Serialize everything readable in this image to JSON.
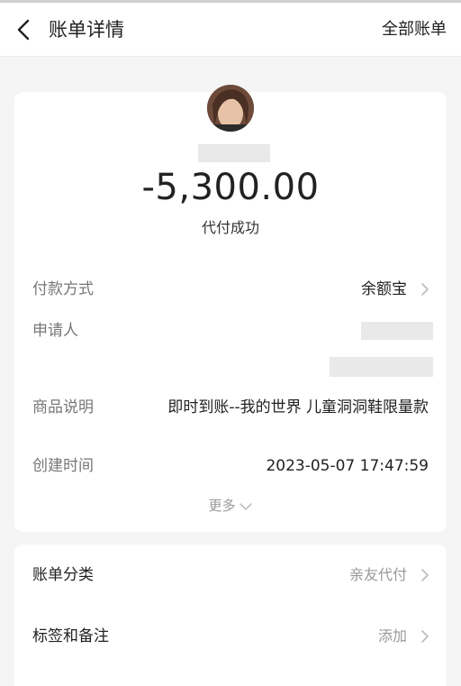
{
  "header": {
    "title": "账单详情",
    "right_link": "全部账单"
  },
  "summary": {
    "amount": "-5,300.00",
    "status": "代付成功"
  },
  "details": {
    "payment_method_label": "付款方式",
    "payment_method_value": "余额宝",
    "applicant_label": "申请人",
    "product_label": "商品说明",
    "product_value": "即时到账--我的世界 儿童洞洞鞋限量款",
    "created_label": "创建时间",
    "created_value": "2023-05-07 17:47:59",
    "more_label": "更多"
  },
  "extras": {
    "category_label": "账单分类",
    "category_value": "亲友代付",
    "tags_label": "标签和备注",
    "tags_value": "添加"
  },
  "icons": [
    "back-arrow-icon",
    "chevron-right-icon",
    "chevron-down-icon",
    "avatar"
  ],
  "colors": {
    "background": "#f5f5f5",
    "card": "#ffffff",
    "muted": "#999999",
    "text": "#222222"
  }
}
